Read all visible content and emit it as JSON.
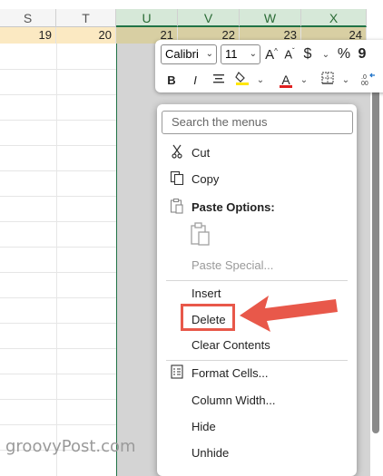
{
  "columns": [
    "S",
    "T",
    "U",
    "V",
    "W",
    "X"
  ],
  "row_numbers": [
    "19",
    "20",
    "21",
    "22",
    "23",
    "24"
  ],
  "toolbar": {
    "font_name": "Calibri",
    "font_size": "11",
    "grow_font": "A",
    "shrink_font": "A",
    "currency": "$",
    "percent": "%",
    "comma": "9",
    "bold": "B",
    "italic": "I",
    "font_color_letter": "A",
    "highlight_color": "#ffe600",
    "font_color": "#e02020"
  },
  "menu": {
    "search_placeholder": "Search the menus",
    "items": [
      {
        "label": "Cut",
        "icon": "scissors-icon"
      },
      {
        "label": "Copy",
        "icon": "copy-icon"
      },
      {
        "label": "Paste Options:",
        "icon": "paste-icon"
      },
      {
        "label": "Paste Special...",
        "icon": ""
      },
      {
        "label": "Insert",
        "icon": ""
      },
      {
        "label": "Delete",
        "icon": ""
      },
      {
        "label": "Clear Contents",
        "icon": ""
      },
      {
        "label": "Format Cells...",
        "icon": "format-cells-icon"
      },
      {
        "label": "Column Width...",
        "icon": ""
      },
      {
        "label": "Hide",
        "icon": ""
      },
      {
        "label": "Unhide",
        "icon": ""
      }
    ]
  },
  "annotation": {
    "highlight_color": "#e8584a"
  },
  "watermark": "groovyPost.com"
}
